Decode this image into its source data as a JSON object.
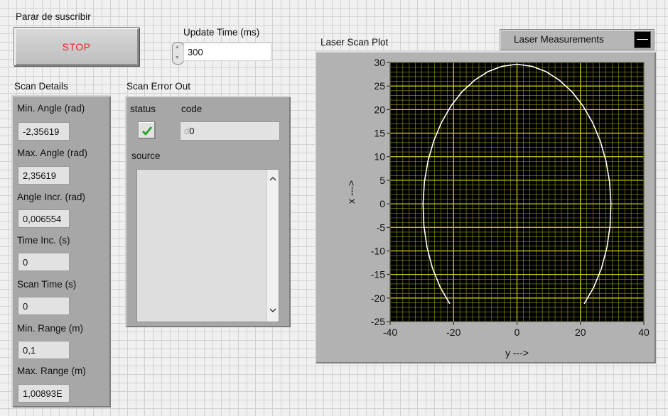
{
  "stop_control": {
    "caption": "Parar de suscribir",
    "button_label": "STOP"
  },
  "update_time": {
    "label": "Update Time (ms)",
    "value": "300"
  },
  "scan_details": {
    "title": "Scan Details",
    "fields": [
      {
        "label": "Min. Angle (rad)",
        "value": "-2,35619"
      },
      {
        "label": "Max. Angle (rad)",
        "value": "2,35619"
      },
      {
        "label": "Angle Incr. (rad)",
        "value": "0,006554"
      },
      {
        "label": "Time Inc. (s)",
        "value": "0"
      },
      {
        "label": "Scan Time (s)",
        "value": "0"
      },
      {
        "label": "Min. Range (m)",
        "value": "0,1"
      },
      {
        "label": "Max. Range (m)",
        "value": "1,00893E"
      }
    ]
  },
  "scan_error": {
    "title": "Scan Error Out",
    "status_label": "status",
    "code_label": "code",
    "code_prefix": "d",
    "code_value": "0",
    "source_label": "source",
    "source_value": "",
    "status_ok": true
  },
  "plot": {
    "title": "Laser Scan Plot",
    "legend_label": "Laser Measurements",
    "plot_bg": "#000000",
    "grid_color": "#c8c81e",
    "trace_color": "#ffffff"
  },
  "chart_data": {
    "type": "line",
    "title": "Laser Scan Plot",
    "xlabel": "y --->",
    "ylabel": "x --->",
    "xlim": [
      -40,
      40
    ],
    "ylim": [
      -25,
      30
    ],
    "xticks": [
      "-40",
      "-20",
      "0",
      "20",
      "40"
    ],
    "yticks": [
      "30",
      "25",
      "20",
      "15",
      "10",
      "5",
      "0",
      "-5",
      "-10",
      "-15",
      "-20",
      "-25"
    ],
    "grid": true,
    "series": [
      {
        "name": "Laser Measurements",
        "x": [
          -21.21,
          -24.27,
          -26.68,
          -28.38,
          -29.35,
          -29.62,
          -29.19,
          -28.05,
          -26.24,
          -23.8,
          -20.79,
          -17.29,
          -13.38,
          -9.17,
          -4.74,
          0,
          4.74,
          9.17,
          13.38,
          17.29,
          20.79,
          23.8,
          26.24,
          28.05,
          29.19,
          29.62,
          29.35,
          28.38,
          26.68,
          24.27,
          21.21
        ],
        "y": [
          -21.21,
          -17.63,
          -13.6,
          -9.22,
          -4.65,
          0,
          4.62,
          9.11,
          13.37,
          17.29,
          20.79,
          23.8,
          26.24,
          28.05,
          29.19,
          29.62,
          29.19,
          28.05,
          26.24,
          23.8,
          20.79,
          17.29,
          13.37,
          9.11,
          4.62,
          0,
          -4.65,
          -9.22,
          -13.6,
          -17.63,
          -21.21
        ]
      }
    ]
  }
}
